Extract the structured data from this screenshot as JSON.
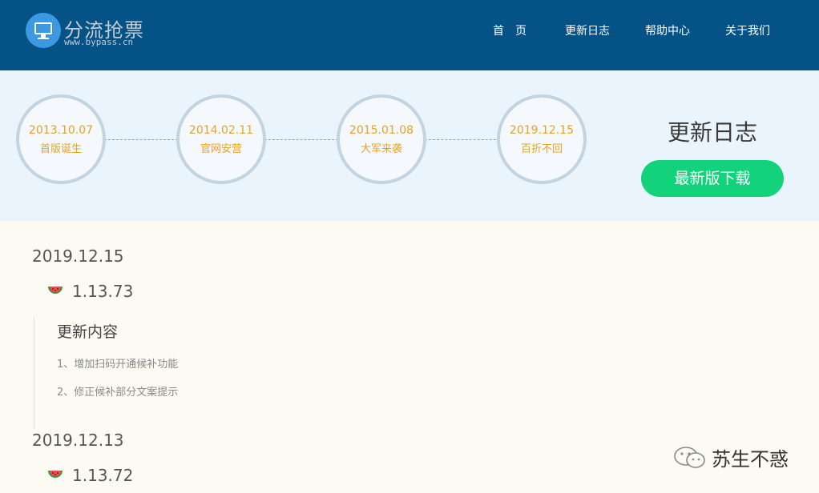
{
  "header": {
    "logo_name": "分流抢票",
    "logo_url": "www.bypass.cn",
    "nav": [
      "首　页",
      "更新日志",
      "帮助中心",
      "关于我们"
    ]
  },
  "banner": {
    "milestones": [
      {
        "date": "2013.10.07",
        "label": "首版诞生"
      },
      {
        "date": "2014.02.11",
        "label": "官网安营"
      },
      {
        "date": "2015.01.08",
        "label": "大军来袭"
      },
      {
        "date": "2019.12.15",
        "label": "百折不回"
      }
    ],
    "title": "更新日志",
    "download_label": "最新版下载"
  },
  "entries": [
    {
      "date": "2019.12.15",
      "version": "1.13.73",
      "notes_title": "更新内容",
      "notes": [
        "1、增加扫码开通候补功能",
        "2、修正候补部分文案提示"
      ]
    },
    {
      "date": "2019.12.13",
      "version": "1.13.72"
    }
  ],
  "watermark": {
    "text": "苏生不惑",
    "icon": "wechat-icon"
  },
  "colors": {
    "header_bg": "#055286",
    "banner_bg": "#eaf4fd",
    "accent_date": "#e3a424",
    "download_button": "#12d27c",
    "content_bg": "#fbfbf3"
  }
}
